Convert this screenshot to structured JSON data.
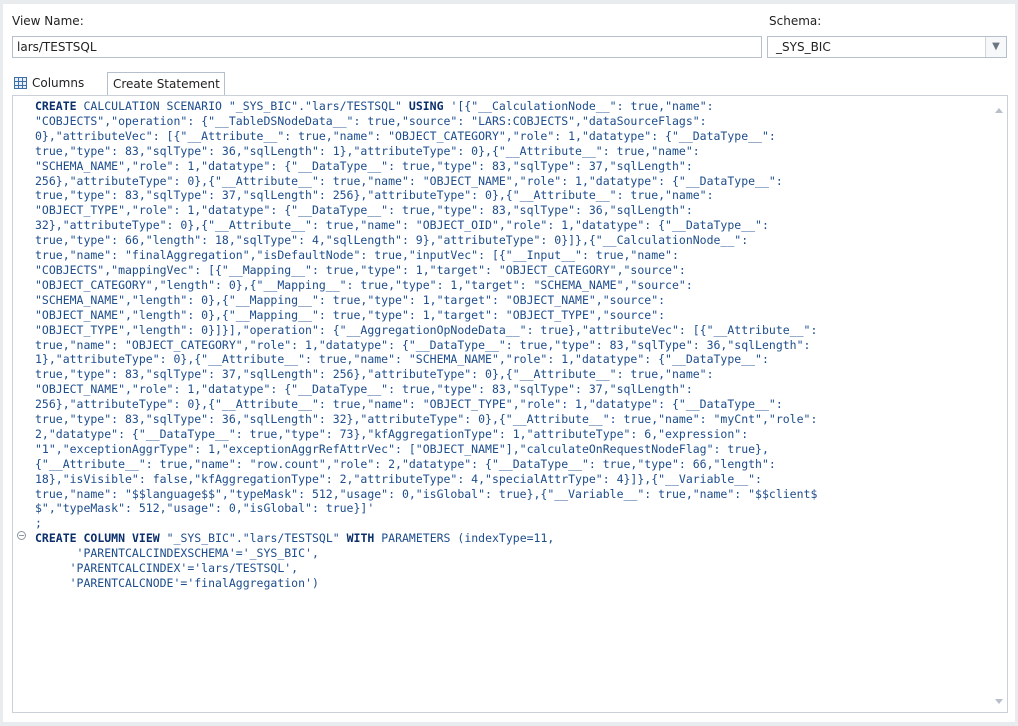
{
  "labels": {
    "view_name": "View Name:",
    "schema": "Schema:"
  },
  "fields": {
    "view_name_value": "lars/TESTSQL",
    "schema_value": "_SYS_BIC"
  },
  "tabs": [
    {
      "label": "Columns",
      "icon": "grid-icon",
      "selected": false
    },
    {
      "label": "Create Statement",
      "selected": true
    }
  ],
  "editor": {
    "lines": [
      [
        {
          "t": "CREATE",
          "k": 1
        },
        {
          "t": " CALCULATION SCENARIO \"_SYS_BIC\".\"lars/TESTSQL\" "
        },
        {
          "t": "USING",
          "k": 1
        },
        {
          "t": " '[{\"__CalculationNode__\": true,\"name\":"
        }
      ],
      [
        {
          "t": "\"COBJECTS\",\"operation\": {\"__TableDSNodeData__\": true,\"source\": \"LARS:COBJECTS\",\"dataSourceFlags\":"
        }
      ],
      [
        {
          "t": "0},\"attributeVec\": [{\"__Attribute__\": true,\"name\": \"OBJECT_CATEGORY\",\"role\": 1,\"datatype\": {\"__DataType__\":"
        }
      ],
      [
        {
          "t": "true,\"type\": 83,\"sqlType\": 36,\"sqlLength\": 1},\"attributeType\": 0},{\"__Attribute__\": true,\"name\":"
        }
      ],
      [
        {
          "t": "\"SCHEMA_NAME\",\"role\": 1,\"datatype\": {\"__DataType__\": true,\"type\": 83,\"sqlType\": 37,\"sqlLength\":"
        }
      ],
      [
        {
          "t": "256},\"attributeType\": 0},{\"__Attribute__\": true,\"name\": \"OBJECT_NAME\",\"role\": 1,\"datatype\": {\"__DataType__\":"
        }
      ],
      [
        {
          "t": "true,\"type\": 83,\"sqlType\": 37,\"sqlLength\": 256},\"attributeType\": 0},{\"__Attribute__\": true,\"name\":"
        }
      ],
      [
        {
          "t": "\"OBJECT_TYPE\",\"role\": 1,\"datatype\": {\"__DataType__\": true,\"type\": 83,\"sqlType\": 36,\"sqlLength\":"
        }
      ],
      [
        {
          "t": "32},\"attributeType\": 0},{\"__Attribute__\": true,\"name\": \"OBJECT_OID\",\"role\": 1,\"datatype\": {\"__DataType__\":"
        }
      ],
      [
        {
          "t": "true,\"type\": 66,\"length\": 18,\"sqlType\": 4,\"sqlLength\": 9},\"attributeType\": 0}]},{\"__CalculationNode__\":"
        }
      ],
      [
        {
          "t": "true,\"name\": \"finalAggregation\",\"isDefaultNode\": true,\"inputVec\": [{\"__Input__\": true,\"name\":"
        }
      ],
      [
        {
          "t": "\"COBJECTS\",\"mappingVec\": [{\"__Mapping__\": true,\"type\": 1,\"target\": \"OBJECT_CATEGORY\",\"source\":"
        }
      ],
      [
        {
          "t": "\"OBJECT_CATEGORY\",\"length\": 0},{\"__Mapping__\": true,\"type\": 1,\"target\": \"SCHEMA_NAME\",\"source\":"
        }
      ],
      [
        {
          "t": "\"SCHEMA_NAME\",\"length\": 0},{\"__Mapping__\": true,\"type\": 1,\"target\": \"OBJECT_NAME\",\"source\":"
        }
      ],
      [
        {
          "t": "\"OBJECT_NAME\",\"length\": 0},{\"__Mapping__\": true,\"type\": 1,\"target\": \"OBJECT_TYPE\",\"source\":"
        }
      ],
      [
        {
          "t": "\"OBJECT_TYPE\",\"length\": 0}]}],\"operation\": {\"__AggregationOpNodeData__\": true},\"attributeVec\": [{\"__Attribute__\":"
        }
      ],
      [
        {
          "t": "true,\"name\": \"OBJECT_CATEGORY\",\"role\": 1,\"datatype\": {\"__DataType__\": true,\"type\": 83,\"sqlType\": 36,\"sqlLength\":"
        }
      ],
      [
        {
          "t": "1},\"attributeType\": 0},{\"__Attribute__\": true,\"name\": \"SCHEMA_NAME\",\"role\": 1,\"datatype\": {\"__DataType__\":"
        }
      ],
      [
        {
          "t": "true,\"type\": 83,\"sqlType\": 37,\"sqlLength\": 256},\"attributeType\": 0},{\"__Attribute__\": true,\"name\":"
        }
      ],
      [
        {
          "t": "\"OBJECT_NAME\",\"role\": 1,\"datatype\": {\"__DataType__\": true,\"type\": 83,\"sqlType\": 37,\"sqlLength\":"
        }
      ],
      [
        {
          "t": "256},\"attributeType\": 0},{\"__Attribute__\": true,\"name\": \"OBJECT_TYPE\",\"role\": 1,\"datatype\": {\"__DataType__\":"
        }
      ],
      [
        {
          "t": "true,\"type\": 83,\"sqlType\": 36,\"sqlLength\": 32},\"attributeType\": 0},{\"__Attribute__\": true,\"name\": \"myCnt\",\"role\":"
        }
      ],
      [
        {
          "t": "2,\"datatype\": {\"__DataType__\": true,\"type\": 73},\"kfAggregationType\": 1,\"attributeType\": 6,\"expression\":"
        }
      ],
      [
        {
          "t": "\"1\",\"exceptionAggrType\": 1,\"exceptionAggrRefAttrVec\": [\"OBJECT_NAME\"],\"calculateOnRequestNodeFlag\": true},"
        }
      ],
      [
        {
          "t": "{\"__Attribute__\": true,\"name\": \"row.count\",\"role\": 2,\"datatype\": {\"__DataType__\": true,\"type\": 66,\"length\":"
        }
      ],
      [
        {
          "t": "18},\"isVisible\": false,\"kfAggregationType\": 2,\"attributeType\": 4,\"specialAttrType\": 4}]},{\"__Variable__\":"
        }
      ],
      [
        {
          "t": "true,\"name\": \"$$language$$\",\"typeMask\": 512,\"usage\": 0,\"isGlobal\": true},{\"__Variable__\": true,\"name\": \"$$client$"
        }
      ],
      [
        {
          "t": "$\",\"typeMask\": 512,\"usage\": 0,\"isGlobal\": true}]'"
        }
      ],
      [
        {
          "t": ";"
        }
      ],
      [
        {
          "t": "CREATE",
          "k": 1
        },
        {
          "t": " "
        },
        {
          "t": "COLUMN",
          "k": 1
        },
        {
          "t": " "
        },
        {
          "t": "VIEW",
          "k": 1
        },
        {
          "t": " \"_SYS_BIC\".\"lars/TESTSQL\" "
        },
        {
          "t": "WITH",
          "k": 1
        },
        {
          "t": " PARAMETERS (indexType=11,"
        }
      ],
      [
        {
          "t": "      'PARENTCALCINDEXSCHEMA'='_SYS_BIC',"
        }
      ],
      [
        {
          "t": "     'PARENTCALCINDEX'='lars/TESTSQL',"
        }
      ],
      [
        {
          "t": "     'PARENTCALCNODE'='finalAggregation')"
        }
      ]
    ]
  }
}
